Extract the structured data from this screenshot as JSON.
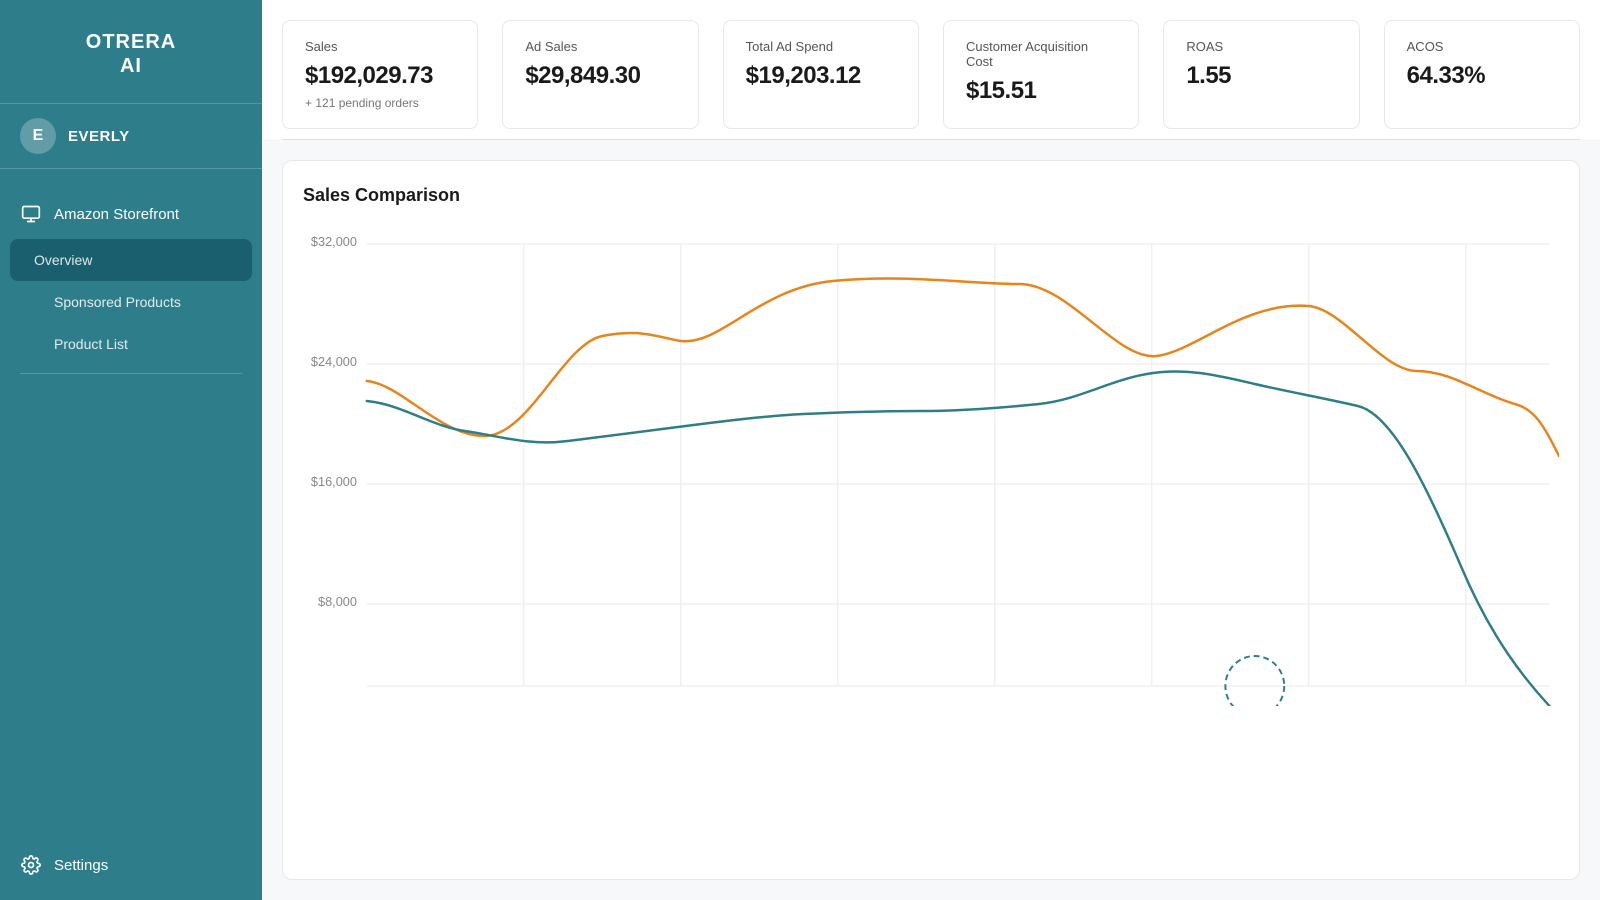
{
  "brand": {
    "name_line1": "OTRERA",
    "name_line2": "AI"
  },
  "user": {
    "initial": "E",
    "name": "EVERLY"
  },
  "sidebar": {
    "amazon_storefront": "Amazon Storefront",
    "overview": "Overview",
    "sponsored_products": "Sponsored Products",
    "product_list": "Product List",
    "settings": "Settings"
  },
  "metrics": [
    {
      "label": "Sales",
      "value": "$192,029.73",
      "sub": "+ 121 pending orders"
    },
    {
      "label": "Ad Sales",
      "value": "$29,849.30",
      "sub": ""
    },
    {
      "label": "Total Ad Spend",
      "value": "$19,203.12",
      "sub": ""
    },
    {
      "label": "Customer Acquisition Cost",
      "value": "$15.51",
      "sub": ""
    },
    {
      "label": "ROAS",
      "value": "1.55",
      "sub": ""
    },
    {
      "label": "ACOS",
      "value": "64.33%",
      "sub": ""
    }
  ],
  "chart": {
    "title": "Sales Comparison",
    "y_labels": [
      "$32,000",
      "$24,000",
      "$16,000",
      "$8,000"
    ]
  }
}
